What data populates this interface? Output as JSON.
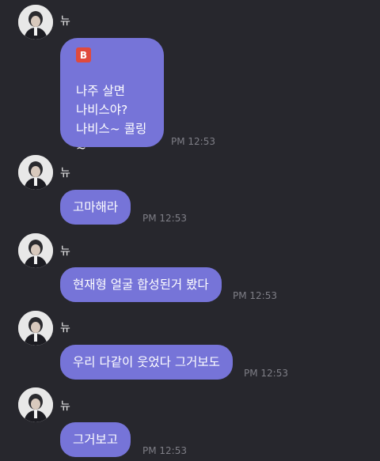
{
  "colors": {
    "background": "#27272d",
    "bubble": "#7674d8",
    "badge": "#e04a3d",
    "timestamp": "#7e7e86"
  },
  "messages": [
    {
      "sender": "뉴",
      "badge": "B",
      "lines": [
        "나주 살면",
        "나비스야?",
        "나비스~ 콜링~"
      ],
      "time": "PM 12:53"
    },
    {
      "sender": "뉴",
      "text": "고마해라",
      "time": "PM 12:53"
    },
    {
      "sender": "뉴",
      "text": "현재형 얼굴 합성된거 봤다",
      "time": "PM 12:53"
    },
    {
      "sender": "뉴",
      "text": "우리 다같이 웃었다 그거보도",
      "time": "PM 12:53"
    },
    {
      "sender": "뉴",
      "text": "그거보고",
      "time": "PM 12:53"
    }
  ]
}
